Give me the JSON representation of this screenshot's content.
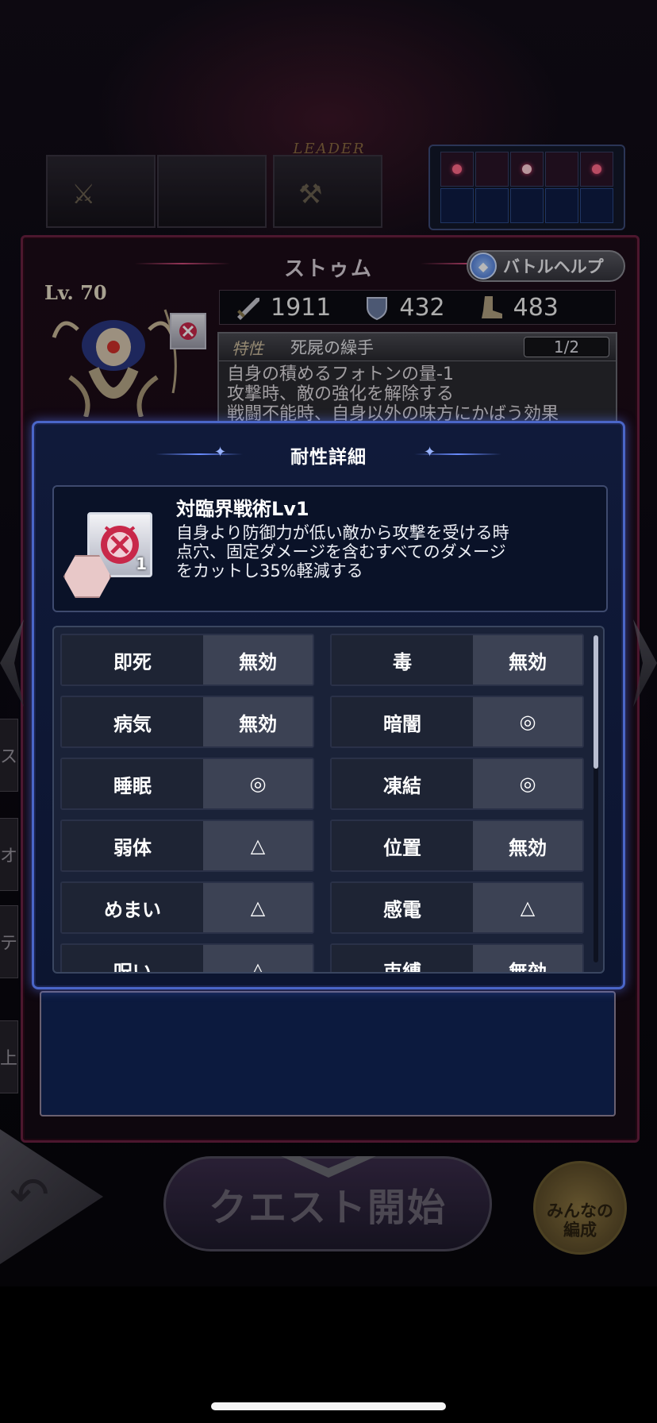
{
  "leader_label": "LEADER",
  "character": {
    "name": "ストゥム",
    "level": "Lv. 70",
    "stats": {
      "attack": "1911",
      "defense": "432",
      "speed": "483"
    }
  },
  "help_button": "バトルヘルプ",
  "trait": {
    "tag": "特性",
    "name": "死屍の繰手",
    "page": "1/2",
    "lines": [
      "自身の積めるフォトンの量-1",
      "攻撃時、敵の強化を解除する",
      "戦闘不能時、自身以外の味方にかばう効果"
    ]
  },
  "formation": {
    "top_row": [
      true,
      false,
      true,
      false,
      true
    ],
    "selected_index": 2
  },
  "side_tabs": [
    "ス",
    "オ",
    "テ",
    "上"
  ],
  "modal": {
    "title": "耐性詳細",
    "skill": {
      "name": "対臨界戦術Lv1",
      "icon_level": "1",
      "description": [
        "自身より防御力が低い敵から攻撃を受ける時",
        "点穴、固定ダメージを含むすべてのダメージ",
        "をカットし35%軽減する"
      ]
    },
    "resistances": [
      [
        {
          "label": "即死",
          "value": "無効"
        },
        {
          "label": "毒",
          "value": "無効"
        }
      ],
      [
        {
          "label": "病気",
          "value": "無効"
        },
        {
          "label": "暗闇",
          "value": "◎"
        }
      ],
      [
        {
          "label": "睡眠",
          "value": "◎"
        },
        {
          "label": "凍結",
          "value": "◎"
        }
      ],
      [
        {
          "label": "弱体",
          "value": "△"
        },
        {
          "label": "位置",
          "value": "無効"
        }
      ],
      [
        {
          "label": "めまい",
          "value": "△"
        },
        {
          "label": "感電",
          "value": "△"
        }
      ],
      [
        {
          "label": "呪い",
          "value": "△"
        },
        {
          "label": "束縛",
          "value": "無効"
        }
      ]
    ]
  },
  "bottom": {
    "quest_button": "クエスト開始",
    "team_button_line1": "みんなの",
    "team_button_line2": "編成"
  },
  "colors": {
    "modal_border": "#4a66c8",
    "panel_border": "#6a2040",
    "selected_cell": "#c8284a"
  }
}
